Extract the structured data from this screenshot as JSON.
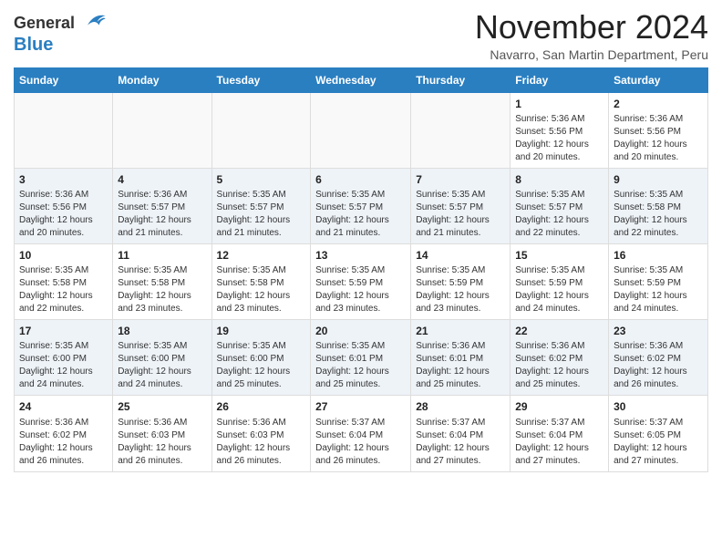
{
  "header": {
    "logo_line1": "General",
    "logo_line2": "Blue",
    "month_title": "November 2024",
    "location": "Navarro, San Martin Department, Peru"
  },
  "calendar": {
    "days_of_week": [
      "Sunday",
      "Monday",
      "Tuesday",
      "Wednesday",
      "Thursday",
      "Friday",
      "Saturday"
    ],
    "weeks": [
      [
        {
          "day": "",
          "info": ""
        },
        {
          "day": "",
          "info": ""
        },
        {
          "day": "",
          "info": ""
        },
        {
          "day": "",
          "info": ""
        },
        {
          "day": "",
          "info": ""
        },
        {
          "day": "1",
          "info": "Sunrise: 5:36 AM\nSunset: 5:56 PM\nDaylight: 12 hours and 20 minutes."
        },
        {
          "day": "2",
          "info": "Sunrise: 5:36 AM\nSunset: 5:56 PM\nDaylight: 12 hours and 20 minutes."
        }
      ],
      [
        {
          "day": "3",
          "info": "Sunrise: 5:36 AM\nSunset: 5:56 PM\nDaylight: 12 hours and 20 minutes."
        },
        {
          "day": "4",
          "info": "Sunrise: 5:36 AM\nSunset: 5:57 PM\nDaylight: 12 hours and 21 minutes."
        },
        {
          "day": "5",
          "info": "Sunrise: 5:35 AM\nSunset: 5:57 PM\nDaylight: 12 hours and 21 minutes."
        },
        {
          "day": "6",
          "info": "Sunrise: 5:35 AM\nSunset: 5:57 PM\nDaylight: 12 hours and 21 minutes."
        },
        {
          "day": "7",
          "info": "Sunrise: 5:35 AM\nSunset: 5:57 PM\nDaylight: 12 hours and 21 minutes."
        },
        {
          "day": "8",
          "info": "Sunrise: 5:35 AM\nSunset: 5:57 PM\nDaylight: 12 hours and 22 minutes."
        },
        {
          "day": "9",
          "info": "Sunrise: 5:35 AM\nSunset: 5:58 PM\nDaylight: 12 hours and 22 minutes."
        }
      ],
      [
        {
          "day": "10",
          "info": "Sunrise: 5:35 AM\nSunset: 5:58 PM\nDaylight: 12 hours and 22 minutes."
        },
        {
          "day": "11",
          "info": "Sunrise: 5:35 AM\nSunset: 5:58 PM\nDaylight: 12 hours and 23 minutes."
        },
        {
          "day": "12",
          "info": "Sunrise: 5:35 AM\nSunset: 5:58 PM\nDaylight: 12 hours and 23 minutes."
        },
        {
          "day": "13",
          "info": "Sunrise: 5:35 AM\nSunset: 5:59 PM\nDaylight: 12 hours and 23 minutes."
        },
        {
          "day": "14",
          "info": "Sunrise: 5:35 AM\nSunset: 5:59 PM\nDaylight: 12 hours and 23 minutes."
        },
        {
          "day": "15",
          "info": "Sunrise: 5:35 AM\nSunset: 5:59 PM\nDaylight: 12 hours and 24 minutes."
        },
        {
          "day": "16",
          "info": "Sunrise: 5:35 AM\nSunset: 5:59 PM\nDaylight: 12 hours and 24 minutes."
        }
      ],
      [
        {
          "day": "17",
          "info": "Sunrise: 5:35 AM\nSunset: 6:00 PM\nDaylight: 12 hours and 24 minutes."
        },
        {
          "day": "18",
          "info": "Sunrise: 5:35 AM\nSunset: 6:00 PM\nDaylight: 12 hours and 24 minutes."
        },
        {
          "day": "19",
          "info": "Sunrise: 5:35 AM\nSunset: 6:00 PM\nDaylight: 12 hours and 25 minutes."
        },
        {
          "day": "20",
          "info": "Sunrise: 5:35 AM\nSunset: 6:01 PM\nDaylight: 12 hours and 25 minutes."
        },
        {
          "day": "21",
          "info": "Sunrise: 5:36 AM\nSunset: 6:01 PM\nDaylight: 12 hours and 25 minutes."
        },
        {
          "day": "22",
          "info": "Sunrise: 5:36 AM\nSunset: 6:02 PM\nDaylight: 12 hours and 25 minutes."
        },
        {
          "day": "23",
          "info": "Sunrise: 5:36 AM\nSunset: 6:02 PM\nDaylight: 12 hours and 26 minutes."
        }
      ],
      [
        {
          "day": "24",
          "info": "Sunrise: 5:36 AM\nSunset: 6:02 PM\nDaylight: 12 hours and 26 minutes."
        },
        {
          "day": "25",
          "info": "Sunrise: 5:36 AM\nSunset: 6:03 PM\nDaylight: 12 hours and 26 minutes."
        },
        {
          "day": "26",
          "info": "Sunrise: 5:36 AM\nSunset: 6:03 PM\nDaylight: 12 hours and 26 minutes."
        },
        {
          "day": "27",
          "info": "Sunrise: 5:37 AM\nSunset: 6:04 PM\nDaylight: 12 hours and 26 minutes."
        },
        {
          "day": "28",
          "info": "Sunrise: 5:37 AM\nSunset: 6:04 PM\nDaylight: 12 hours and 27 minutes."
        },
        {
          "day": "29",
          "info": "Sunrise: 5:37 AM\nSunset: 6:04 PM\nDaylight: 12 hours and 27 minutes."
        },
        {
          "day": "30",
          "info": "Sunrise: 5:37 AM\nSunset: 6:05 PM\nDaylight: 12 hours and 27 minutes."
        }
      ]
    ]
  }
}
